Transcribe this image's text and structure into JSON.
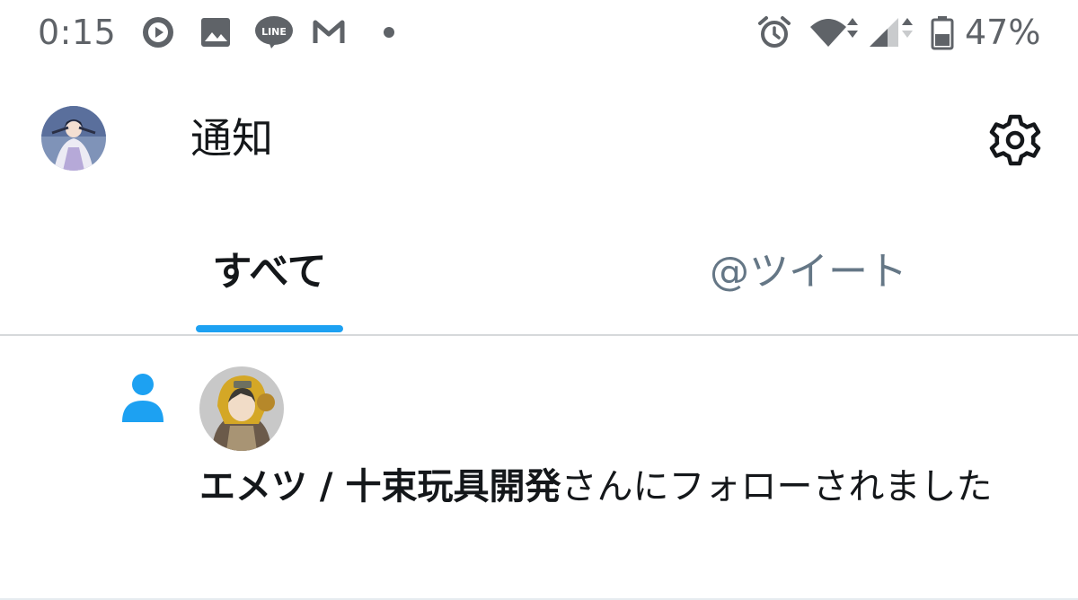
{
  "status_bar": {
    "time": "0:15",
    "battery_percent": "47%",
    "notification_icons": [
      "play-circle-icon",
      "image-icon",
      "line-app-icon",
      "gmail-icon"
    ],
    "line_badge_text": "LINE",
    "system_icons": [
      "alarm-icon",
      "wifi-icon",
      "cell-signal-icon",
      "battery-icon"
    ]
  },
  "header": {
    "title": "通知",
    "avatar_icon": "profile-avatar",
    "settings_icon": "gear-icon"
  },
  "tabs": [
    {
      "label": "すべて",
      "selected": true
    },
    {
      "label": "@ツイート",
      "selected": false
    }
  ],
  "notification": {
    "type_icon": "person-icon",
    "user_name": "エメツ / 十束玩具開発",
    "message_suffix": "さんにフォローされました"
  },
  "colors": {
    "accent": "#1da1f2",
    "text_primary": "#14171a",
    "text_secondary": "#657786",
    "status_bar": "#5f6368",
    "divider": "#d6d9db"
  }
}
